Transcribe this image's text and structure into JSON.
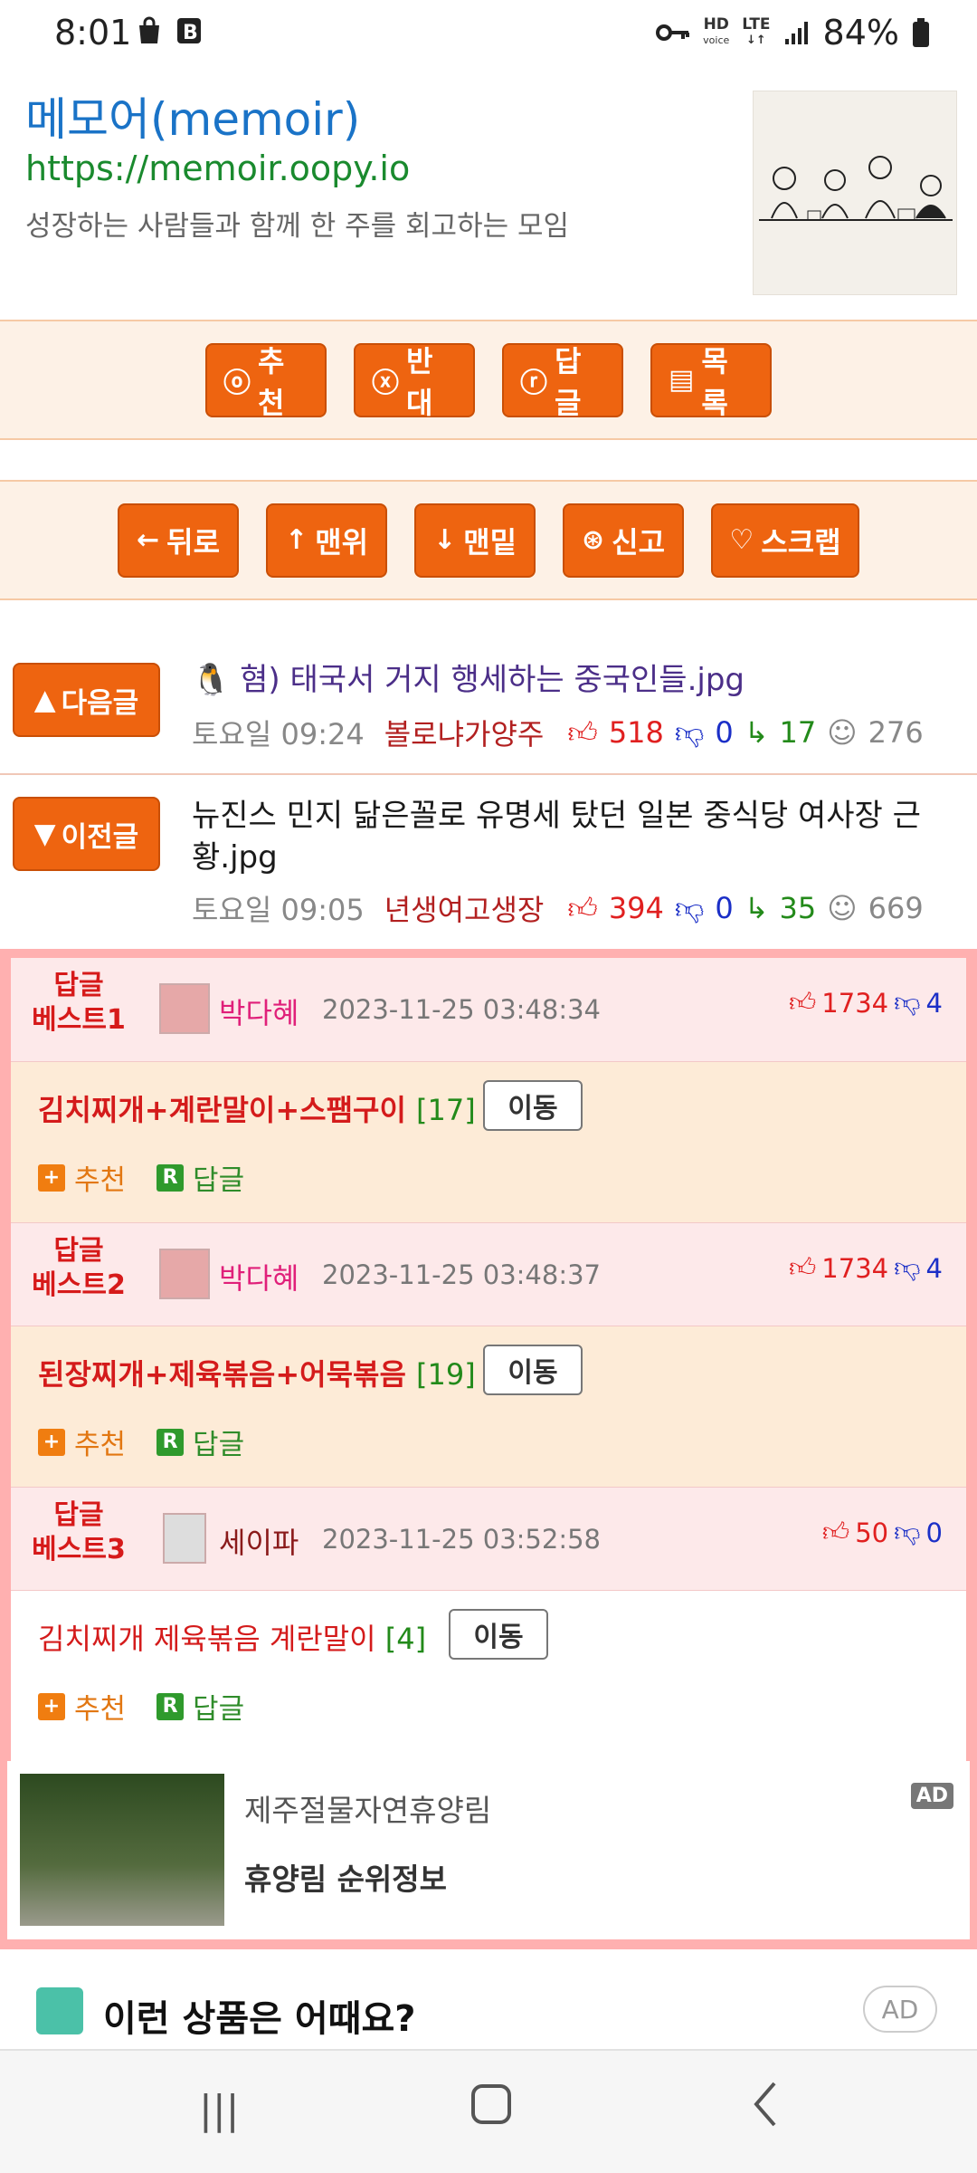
{
  "status_bar": {
    "time": "8:01",
    "net_hd": "HD",
    "net_voice": "voice",
    "net_lte": "LTE",
    "battery": "84%"
  },
  "header": {
    "title": "메모어(memoir)",
    "url": "https://memoir.oopy.io",
    "description": "성장하는 사람들과 함께 한 주를 회고하는 모임"
  },
  "action_bar": {
    "recommend": "추천",
    "oppose": "반대",
    "reply": "답글",
    "list": "목록"
  },
  "nav_bar": {
    "back": "뒤로",
    "top": "맨위",
    "bottom": "맨밑",
    "report": "신고",
    "scrap": "스크랩"
  },
  "next_post": {
    "button": "다음글",
    "title": "혐) 태국서 거지 행세하는 중국인들.jpg",
    "time": "토요일 09:24",
    "author": "볼로냐가양주",
    "up": "518",
    "down": "0",
    "replies": "17",
    "views": "276"
  },
  "prev_post": {
    "button": "이전글",
    "title": "뉴진스 민지 닮은꼴로 유명세 탔던 일본 중식당 여사장 근황.jpg",
    "time": "토요일 09:05",
    "author": "년생여고생장",
    "up": "394",
    "down": "0",
    "replies": "35",
    "views": "669"
  },
  "best_replies": [
    {
      "label_top": "답글",
      "label_bottom": "베스트1",
      "author": "박다혜",
      "date": "2023-11-25 03:48:34",
      "up": "1734",
      "down": "4",
      "text": "김치찌개+계란말이+스팸구이",
      "count": "[17]",
      "move": "이동",
      "recommend": "추천",
      "reply": "답글"
    },
    {
      "label_top": "답글",
      "label_bottom": "베스트2",
      "author": "박다혜",
      "date": "2023-11-25 03:48:37",
      "up": "1734",
      "down": "4",
      "text": "된장찌개+제육볶음+어묵볶음",
      "count": "[19]",
      "move": "이동",
      "recommend": "추천",
      "reply": "답글"
    },
    {
      "label_top": "답글",
      "label_bottom": "베스트3",
      "author": "세이파",
      "date": "2023-11-25 03:52:58",
      "up": "50",
      "down": "0",
      "text": "김치찌개 제육볶음 계란말이",
      "count": "[4]",
      "move": "이동",
      "recommend": "추천",
      "reply": "답글"
    }
  ],
  "ad": {
    "title": "제주절물자연휴양림",
    "subtitle": "휴양림 순위정보",
    "badge": "AD"
  },
  "product_section": {
    "title": "이런 상품은 어때요?",
    "ad": "AD"
  },
  "colors": {
    "accent_orange": "#ee6410",
    "best_border": "#ffb0b0",
    "link_blue": "#1a73c7"
  }
}
